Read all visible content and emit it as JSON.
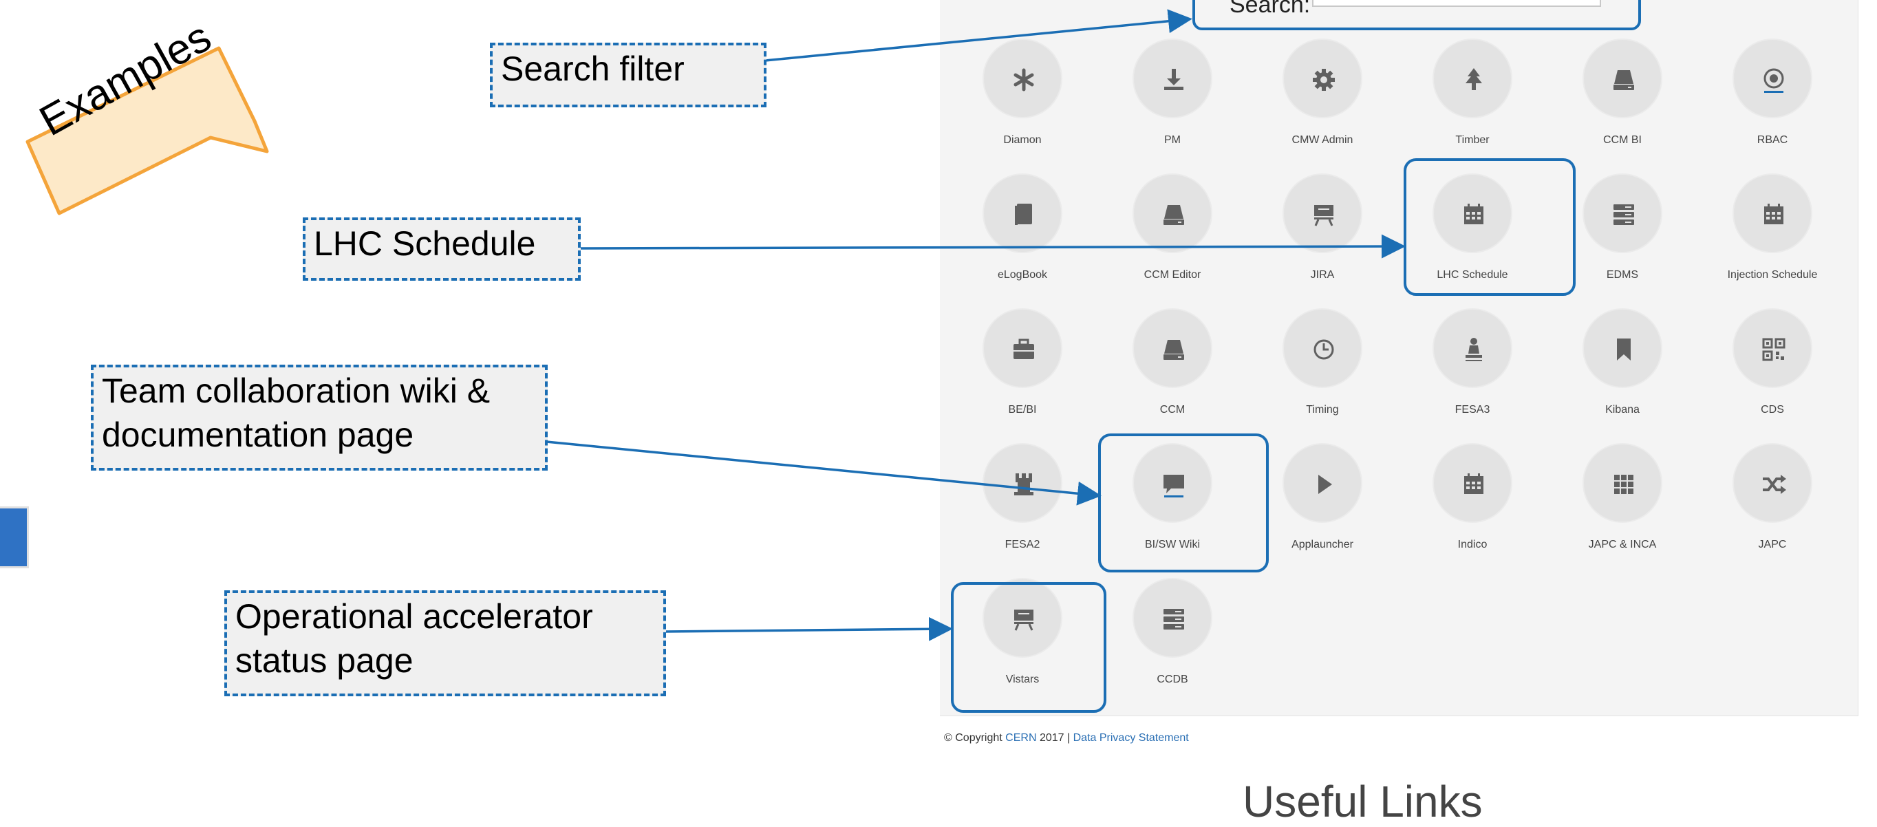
{
  "search": {
    "label": "Search:",
    "value": ""
  },
  "tiles": [
    {
      "label": "Diamon",
      "icon": "asterisk-icon"
    },
    {
      "label": "PM",
      "icon": "download-icon"
    },
    {
      "label": "CMW Admin",
      "icon": "gear-icon"
    },
    {
      "label": "Timber",
      "icon": "tree-icon"
    },
    {
      "label": "CCM BI",
      "icon": "hdd-icon"
    },
    {
      "label": "RBAC",
      "icon": "record-icon"
    },
    {
      "label": "eLogBook",
      "icon": "book-icon"
    },
    {
      "label": "CCM Editor",
      "icon": "hdd-icon"
    },
    {
      "label": "JIRA",
      "icon": "blackboard-icon"
    },
    {
      "label": "LHC Schedule",
      "icon": "calendar-icon"
    },
    {
      "label": "EDMS",
      "icon": "tasks-icon"
    },
    {
      "label": "Injection Schedule",
      "icon": "calendar-icon"
    },
    {
      "label": "BE/BI",
      "icon": "briefcase-icon"
    },
    {
      "label": "CCM",
      "icon": "hdd-icon"
    },
    {
      "label": "Timing",
      "icon": "clock-icon"
    },
    {
      "label": "FESA3",
      "icon": "pawn-icon"
    },
    {
      "label": "Kibana",
      "icon": "bookmark-icon"
    },
    {
      "label": "CDS",
      "icon": "qrcode-icon"
    },
    {
      "label": "FESA2",
      "icon": "tower-icon"
    },
    {
      "label": "BI/SW Wiki",
      "icon": "comment-icon"
    },
    {
      "label": "Applauncher",
      "icon": "play-icon"
    },
    {
      "label": "Indico",
      "icon": "calendar-icon"
    },
    {
      "label": "JAPC & INCA",
      "icon": "grid-icon"
    },
    {
      "label": "JAPC",
      "icon": "shuffle-icon"
    },
    {
      "label": "Vistars",
      "icon": "blackboard-icon"
    },
    {
      "label": "CCDB",
      "icon": "tasks-icon"
    }
  ],
  "callouts": {
    "search_filter": "Search filter",
    "lhc_schedule": "LHC Schedule",
    "wiki": "Team collaboration wiki &\ndocumentation page",
    "status": "Operational accelerator\nstatus page"
  },
  "examples_label": "Examples",
  "footer": {
    "prefix": "© Copyright",
    "org": "CERN",
    "year_sep": "2017 |",
    "privacy": "Data Privacy Statement"
  },
  "caption": "Useful Links",
  "colors": {
    "accent": "#1b6eb4",
    "callout_bg": "#f0f0f0",
    "examples_bg": "#fde9c8",
    "examples_border": "#f4a43a",
    "icon": "#606060"
  }
}
